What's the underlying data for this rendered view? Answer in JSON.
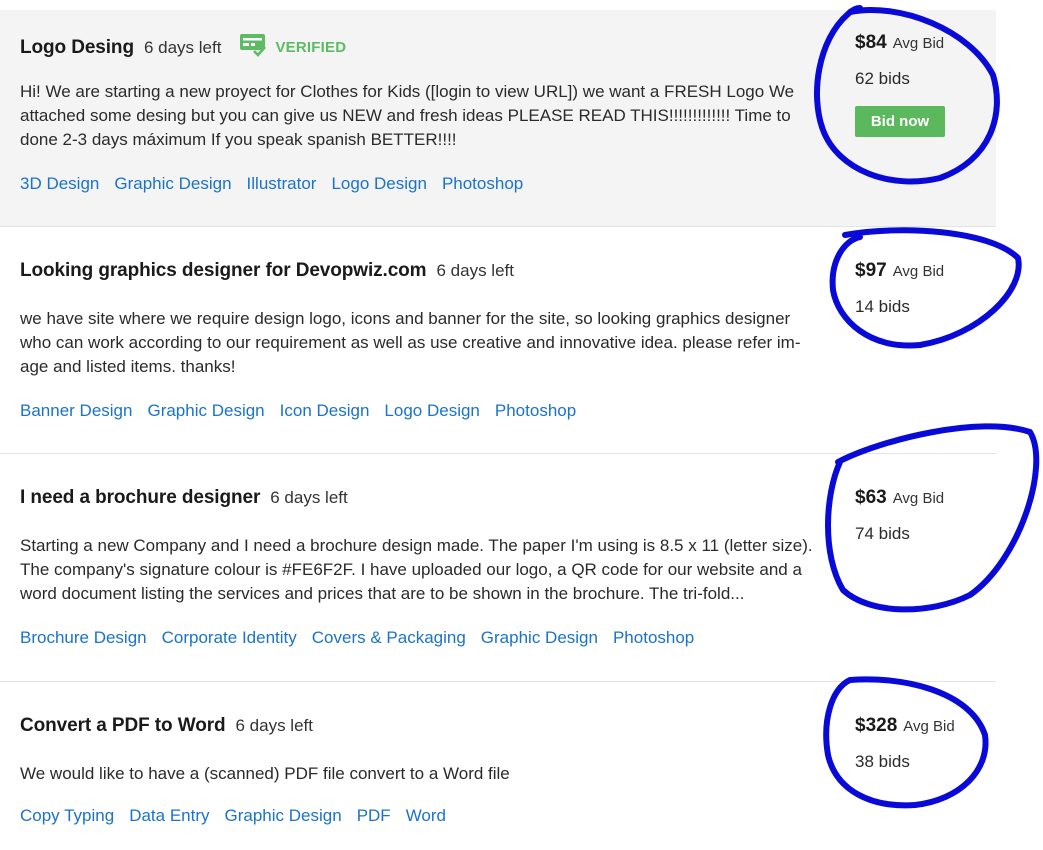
{
  "projects": [
    {
      "title": "Logo Desing",
      "days_left": "6 days left",
      "verified": "VERIFIED",
      "description": "Hi! We are starting a new proyect for Clothes for Kids ([login to view URL]) we want a FRESH Logo We attached some desing but you can give us NEW and fresh ideas PLEASE READ THIS!!!!!!!!!!!!! Time to done 2-3 days máximum If you speak spanish BETTER!!!!",
      "tags": [
        "3D Design",
        "Graphic Design",
        "Illustrator",
        "Logo Design",
        "Photoshop"
      ],
      "avg_bid": "$84",
      "avg_label": "Avg Bid",
      "bids": "62 bids",
      "bid_button": "Bid now"
    },
    {
      "title": "Looking graphics designer for Devopwiz.com",
      "days_left": "6 days left",
      "description": "we have site where we require design logo, icons and banner for the site, so looking graphics designer who can work according to our requirement as well as use creative and innovative idea. please refer im-age and listed items. thanks!",
      "tags": [
        "Banner Design",
        "Graphic Design",
        "Icon Design",
        "Logo Design",
        "Photoshop"
      ],
      "avg_bid": "$97",
      "avg_label": "Avg Bid",
      "bids": "14 bids"
    },
    {
      "title": "I need a brochure designer",
      "days_left": "6 days left",
      "description": "Starting a new Company and I need a brochure design made. The paper I'm using is 8.5 x 11 (letter size). The company's signature colour is #FE6F2F. I have uploaded our logo, a QR code for our website and a word document listing the services and prices that are to be shown in the brochure. The tri-fold...",
      "tags": [
        "Brochure Design",
        "Corporate Identity",
        "Covers & Packaging",
        "Graphic Design",
        "Photoshop"
      ],
      "avg_bid": "$63",
      "avg_label": "Avg Bid",
      "bids": "74 bids"
    },
    {
      "title": "Convert a PDF to Word",
      "days_left": "6 days left",
      "description": "We would like to have a (scanned) PDF file convert to a Word file",
      "tags": [
        "Copy Typing",
        "Data Entry",
        "Graphic Design",
        "PDF",
        "Word"
      ],
      "avg_bid": "$328",
      "avg_label": "Avg Bid",
      "bids": "38 bids"
    }
  ],
  "colors": {
    "tag_link": "#1a73c9",
    "verified_green": "#5dbb63",
    "bid_button": "#5cb85c",
    "annotation_circles": "#0a0ad8",
    "highlight_bg": "#f4f4f4"
  }
}
